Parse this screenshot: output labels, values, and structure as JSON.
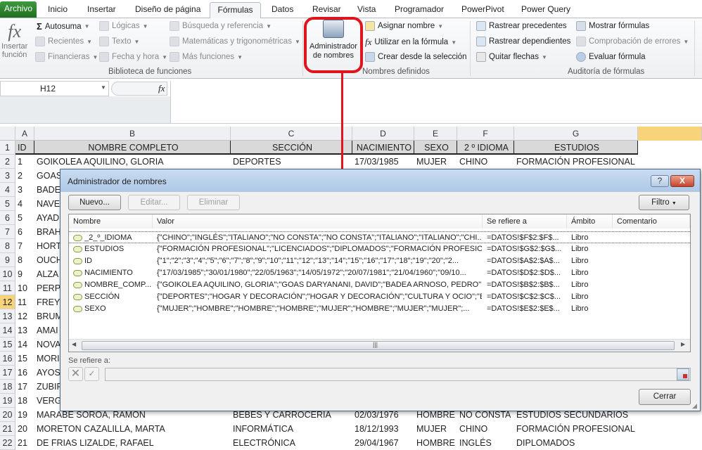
{
  "tabs": [
    "Archivo",
    "Inicio",
    "Insertar",
    "Diseño de página",
    "Fórmulas",
    "Datos",
    "Revisar",
    "Vista",
    "Programador",
    "PowerPivot",
    "Power Query"
  ],
  "ribbon": {
    "insert_function": [
      "Insertar",
      "función"
    ],
    "lib": {
      "autosuma": "Autosuma",
      "recientes": "Recientes",
      "financieras": "Financieras",
      "logicas": "Lógicas",
      "texto": "Texto",
      "fecha": "Fecha y hora",
      "busqueda": "Búsqueda y referencia",
      "matematicas": "Matemáticas y trigonométricas",
      "mas": "Más funciones",
      "label": "Biblioteca de funciones"
    },
    "names": {
      "admin": [
        "Administrador",
        "de nombres"
      ],
      "asignar": "Asignar nombre",
      "utilizar": "Utilizar en la fórmula",
      "crear": "Crear desde la selección",
      "label": "Nombres definidos"
    },
    "audit": {
      "precedentes": "Rastrear precedentes",
      "dependientes": "Rastrear dependientes",
      "quitar": "Quitar flechas",
      "mostrar": "Mostrar fórmulas",
      "comprobacion": "Comprobación de errores",
      "evaluar": "Evaluar fórmula",
      "label": "Auditoría de fórmulas"
    }
  },
  "formula_bar": {
    "name_box": "H12",
    "fx": "fx",
    "value": ""
  },
  "sheet": {
    "columns": [
      "A",
      "B",
      "C",
      "D",
      "E",
      "F",
      "G"
    ],
    "header": [
      "ID",
      "NOMBRE COMPLETO",
      "SECCIÓN",
      "NACIMIENTO",
      "SEXO",
      "2 º IDIOMA",
      "ESTUDIOS"
    ],
    "rows": [
      [
        "1",
        "GOIKOLEA AQUILINO, GLORIA",
        "DEPORTES",
        "17/03/1985",
        "MUJER",
        "CHINO",
        "FORMACIÓN PROFESIONAL"
      ],
      [
        "2",
        "GOAS"
      ],
      [
        "3",
        "BADE"
      ],
      [
        "4",
        "NAVE"
      ],
      [
        "5",
        "AYAD"
      ],
      [
        "6",
        "BRAH"
      ],
      [
        "7",
        "HORT"
      ],
      [
        "8",
        "OUCH"
      ],
      [
        "9",
        "ALZA"
      ],
      [
        "10",
        "PERP"
      ],
      [
        "11",
        "FREY"
      ],
      [
        "12",
        "BRUM"
      ],
      [
        "13",
        "AMAI"
      ],
      [
        "14",
        "NOVA"
      ],
      [
        "15",
        "MORI"
      ],
      [
        "16",
        "AYOS"
      ],
      [
        "17",
        "ZUBIF"
      ],
      [
        "18",
        "VERG"
      ],
      [
        "19",
        "MARABE SOROA, RAMON",
        "BEBES Y CARROCERIA",
        "02/03/1976",
        "HOMBRE",
        "NO CONSTA",
        "ESTUDIOS SECUNDARIOS"
      ],
      [
        "20",
        "MORETON CAZALILLA, MARTA",
        "INFORMÁTICA",
        "18/12/1993",
        "MUJER",
        "CHINO",
        "FORMACIÓN PROFESIONAL"
      ],
      [
        "21",
        "DE FRIAS LIZALDE, RAFAEL",
        "ELECTRÓNICA",
        "29/04/1967",
        "HOMBRE",
        "INGLÉS",
        "DIPLOMADOS"
      ]
    ],
    "selected_row": 12
  },
  "dialog": {
    "title": "Administrador de nombres",
    "buttons": {
      "nuevo": "Nuevo...",
      "editar": "Editar...",
      "eliminar": "Eliminar",
      "filtro": "Filtro",
      "cerrar": "Cerrar",
      "help": "?",
      "close": "X"
    },
    "columns": [
      "Nombre",
      "Valor",
      "Se refiere a",
      "Ámbito",
      "Comentario"
    ],
    "names": [
      [
        "_2_º_IDIOMA",
        "{\"CHINO\";\"INGLÉS\";\"ITALIANO\";\"NO CONSTA\";\"NO CONSTA\";\"ITALIANO\";\"ITALIANO\";\"CHI...",
        "=DATOS!$F$2:$F$...",
        "Libro",
        ""
      ],
      [
        "ESTUDIOS",
        "{\"FORMACIÓN PROFESIONAL\";\"LICENCIADOS\";\"DIPLOMADOS\";\"FORMACIÓN PROFESIONA...",
        "=DATOS!$G$2:$G$...",
        "Libro",
        ""
      ],
      [
        "ID",
        "{\"1\";\"2\";\"3\";\"4\";\"5\";\"6\";\"7\";\"8\";\"9\";\"10\";\"11\";\"12\";\"13\";\"14\";\"15\";\"16\";\"17\";\"18\";\"19\";\"20\";\"2...",
        "=DATOS!$A$2:$A$...",
        "Libro",
        ""
      ],
      [
        "NACIMIENTO",
        "{\"17/03/1985\";\"30/01/1980\";\"22/05/1963\";\"14/05/1972\";\"20/07/1981\";\"21/04/1960\";\"09/10...",
        "=DATOS!$D$2:$D$...",
        "Libro",
        ""
      ],
      [
        "NOMBRE_COMP...",
        "{\"GOIKOLEA AQUILINO, GLORIA\";\"GOAS DARYANANI, DAVID\";\"BADEA ARNOSO, PEDRO\";\"...",
        "=DATOS!$B$2:$B$...",
        "Libro",
        ""
      ],
      [
        "SECCIÓN",
        "{\"DEPORTES\";\"HOGAR Y DECORACIÓN\";\"HOGAR Y DECORACIÓN\";\"CULTURA Y OCIO\";\"BEB...",
        "=DATOS!$C$2:$C$...",
        "Libro",
        ""
      ],
      [
        "SEXO",
        "{\"MUJER\";\"HOMBRE\";\"HOMBRE\";\"HOMBRE\";\"MUJER\";\"HOMBRE\";\"MUJER\";\"MUJER\";...",
        "=DATOS!$E$2:$E$...",
        "Libro",
        ""
      ]
    ],
    "refers_label": "Se refiere a:",
    "refers_value": ""
  },
  "colors": {
    "highlight": "#e0141e",
    "file_tab": "#2a7d2a",
    "selected_row_header": "#f8d37a"
  }
}
